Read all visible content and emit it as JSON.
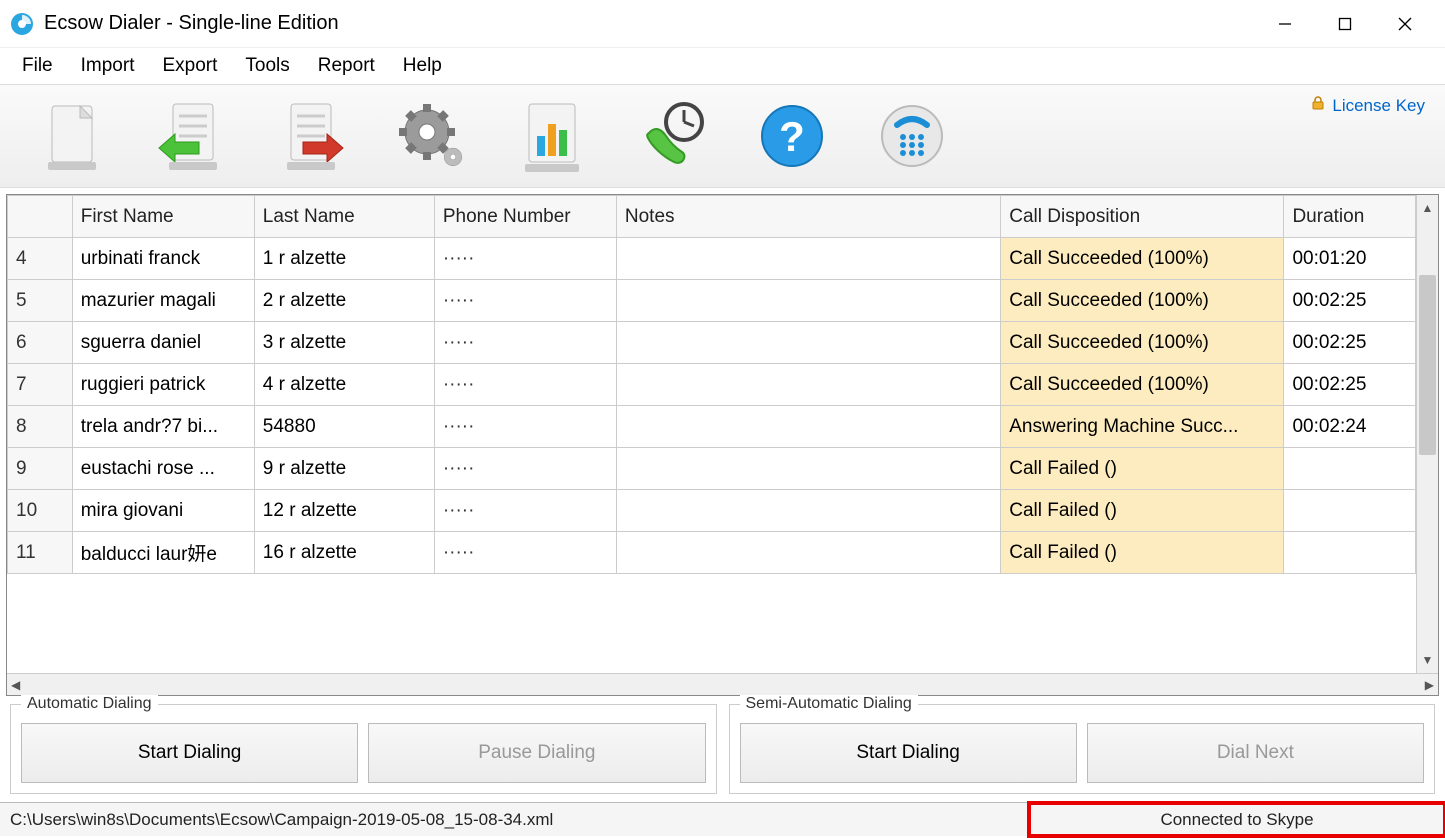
{
  "window": {
    "title": "Ecsow Dialer - Single-line Edition"
  },
  "menu": {
    "items": [
      "File",
      "Import",
      "Export",
      "Tools",
      "Report",
      "Help"
    ]
  },
  "toolbar": {
    "license_link": "License Key",
    "buttons": [
      {
        "name": "new-document",
        "hint": "New"
      },
      {
        "name": "import",
        "hint": "Import"
      },
      {
        "name": "export",
        "hint": "Export"
      },
      {
        "name": "settings",
        "hint": "Settings"
      },
      {
        "name": "reports",
        "hint": "Reports"
      },
      {
        "name": "call-history",
        "hint": "Call History"
      },
      {
        "name": "help",
        "hint": "Help"
      },
      {
        "name": "dialpad",
        "hint": "Dialpad"
      }
    ]
  },
  "grid": {
    "columns": [
      "",
      "First Name",
      "Last Name",
      "Phone Number",
      "Notes",
      "Call Disposition",
      "Duration"
    ],
    "rows": [
      {
        "n": "4",
        "first": "urbinati franck",
        "last": "1 r alzette",
        "phone": "·····",
        "notes": "",
        "disp": "Call Succeeded (100%)",
        "dur": "00:01:20"
      },
      {
        "n": "5",
        "first": "mazurier magali",
        "last": "2 r alzette",
        "phone": "·····",
        "notes": "",
        "disp": "Call Succeeded (100%)",
        "dur": "00:02:25"
      },
      {
        "n": "6",
        "first": "sguerra daniel",
        "last": "3 r alzette",
        "phone": "·····",
        "notes": "",
        "disp": "Call Succeeded (100%)",
        "dur": "00:02:25"
      },
      {
        "n": "7",
        "first": "ruggieri patrick",
        "last": "4 r alzette",
        "phone": "·····",
        "notes": "",
        "disp": "Call Succeeded (100%)",
        "dur": "00:02:25"
      },
      {
        "n": "8",
        "first": "trela andr?7 bi...",
        "last": "54880",
        "phone": "·····",
        "notes": "",
        "disp": "Answering Machine Succ...",
        "dur": "00:02:24"
      },
      {
        "n": "9",
        "first": "eustachi rose ...",
        "last": "9 r alzette",
        "phone": "·····",
        "notes": "",
        "disp": "Call Failed ()",
        "dur": ""
      },
      {
        "n": "10",
        "first": "mira giovani",
        "last": "12 r alzette",
        "phone": "·····",
        "notes": "",
        "disp": "Call Failed ()",
        "dur": ""
      },
      {
        "n": "11",
        "first": "balducci laur妍e",
        "last": "16 r alzette",
        "phone": "·····",
        "notes": "",
        "disp": "Call Failed ()",
        "dur": ""
      }
    ]
  },
  "panels": {
    "auto": {
      "title": "Automatic Dialing",
      "start": "Start Dialing",
      "pause": "Pause Dialing"
    },
    "semi": {
      "title": "Semi-Automatic Dialing",
      "start": "Start Dialing",
      "next": "Dial Next"
    }
  },
  "status": {
    "path": "C:\\Users\\win8s\\Documents\\Ecsow\\Campaign-2019-05-08_15-08-34.xml",
    "connection": "Connected to Skype"
  }
}
